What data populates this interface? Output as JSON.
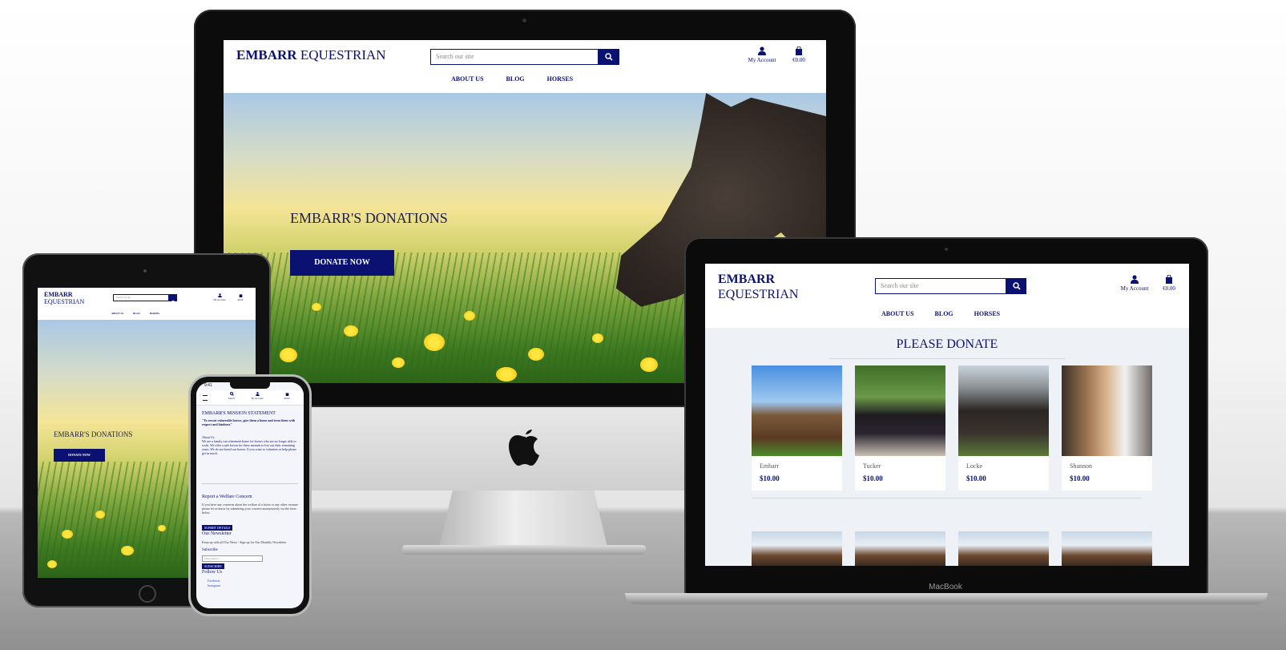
{
  "site": {
    "logo_bold": "EMBARR",
    "logo_regular": " EQUESTRIAN",
    "logo_regular_wrapped": "EQUESTRIAN",
    "search_placeholder": "Search our site",
    "account_label": "My Account",
    "bag_total": "€0.00",
    "nav": [
      "ABOUT US",
      "BLOG",
      "HORSES"
    ]
  },
  "desktop": {
    "hero_title": "EMBARR'S DONATIONS",
    "hero_button": "DONATE NOW"
  },
  "tablet": {
    "hero_title": "EMBARR'S DONATIONS",
    "hero_button": "DONATE NOW"
  },
  "phone": {
    "time": "9:41",
    "nav_search": "Search",
    "nav_account": "My Account",
    "nav_bag": "€0.00",
    "mission_title": "EMBARR'S MISSION STATEMENT",
    "mission_quote": "\"To rescue vulnerable horses, give them a home and treat them with respect and kindness\"",
    "about_heading": "About Us",
    "about_text": "We are a family run retirement home for horses who are no longer able to work. We offer a safe haven for these animals to live out their remaining years. We do not breed our horses. If you want to volunteer or help please get in touch.",
    "welfare_title": "Report a Welfare Concern",
    "welfare_text": "If you have any concerns about the welfare of a horse or any other creature please let us know by submitting your concern anonymously via the form below.",
    "welfare_button": "SUBMIT DETAILS",
    "newsletter_title": "Our Newsletter",
    "newsletter_text": "Keep up with all Our News - Sign up for Our Monthly Newsletter",
    "subscribe_label": "Subscribe",
    "email_placeholder": "Email Address *",
    "subscribe_button": "SUBSCRIBE",
    "follow_title": "Follow Us",
    "social": [
      "Facebook",
      "Instagram"
    ]
  },
  "laptop": {
    "section_title": "PLEASE DONATE",
    "horses": [
      {
        "name": "Embarr",
        "price": "$10.00"
      },
      {
        "name": "Tucker",
        "price": "$10.00"
      },
      {
        "name": "Locke",
        "price": "$10.00"
      },
      {
        "name": "Shannon",
        "price": "$10.00"
      }
    ],
    "device_label": "MacBook"
  },
  "colors": {
    "brand_navy": "#0b1170",
    "page_bg": "#ffffff",
    "card_bg": "#ffffff",
    "laptop_content_bg": "#eef1f6"
  },
  "icons": [
    "search-icon",
    "user-icon",
    "shopping-bag-icon",
    "apple-logo-icon",
    "menu-icon"
  ]
}
